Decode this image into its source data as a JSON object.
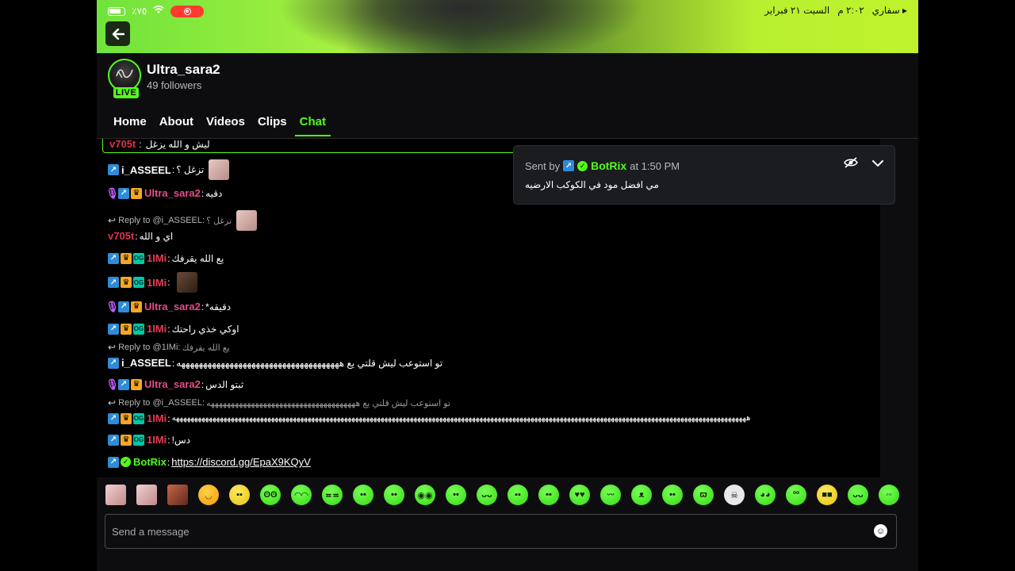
{
  "status_bar": {
    "battery": "٪٧٥",
    "carrier": "سفاري",
    "time": "٢:٠٢ م",
    "date": "السبت ٢١ فبراير"
  },
  "channel": {
    "name": "Ultra_sara2",
    "followers": "49 followers",
    "live_label": "LIVE"
  },
  "tabs": [
    "Home",
    "About",
    "Videos",
    "Clips",
    "Chat"
  ],
  "pinned_row": {
    "user": "v705t",
    "text": "ليش و الله يزغل"
  },
  "messages": [
    {
      "user": "i_ASSEEL",
      "text": "تزغل ؟"
    },
    {
      "user": "Ultra_sara2",
      "text": "دقيه"
    },
    {
      "reply_to": "Reply to @i_ASSEEL:",
      "reply_text": "تزغل ؟"
    },
    {
      "user": "v705t",
      "text": "اي و الله"
    },
    {
      "user": "1IMi",
      "text": "يع الله يقرفك"
    },
    {
      "user": "1IMi",
      "text": ""
    },
    {
      "user": "Ultra_sara2",
      "text": "دقيقه*"
    },
    {
      "user": "1IMi",
      "text": "اوكي خذي راحتك"
    },
    {
      "reply_to": "Reply to @1IMi:",
      "reply_text": "يع الله يقرفك"
    },
    {
      "user": "i_ASSEEL",
      "text": "تو استوعب ليش قلتي يع هههههههههههههههههههههههههههههههههههههه"
    },
    {
      "user": "Ultra_sara2",
      "text": "ثبتو الدس"
    },
    {
      "reply_to": "Reply to @i_ASSEEL:",
      "reply_text": "تو استوعب ليش قلتي يع هههههههههههههههههههههههههههههههههههههه"
    },
    {
      "user": "1IMi",
      "text": "هههههههههههههههههههههههههههههههههههههههههههههههههههههههههههههههههههههههههههههههههههههههههههههههههههههههههههههههههههههههههههههههههههههههههههههههههههههههههههههه"
    },
    {
      "user": "1IMi",
      "text": "دس!"
    },
    {
      "user": "BotRix",
      "text": "https://discord.gg/EpaX9KQyV"
    }
  ],
  "popup": {
    "sent_by": "Sent by",
    "user": "BotRix",
    "at": "at 1:50 PM",
    "text": "مي افضل مود في الكوكب الارضيه"
  },
  "input": {
    "placeholder": "Send a message"
  },
  "colors": {
    "accent": "#53fc18",
    "background": "#0d0d0f"
  }
}
